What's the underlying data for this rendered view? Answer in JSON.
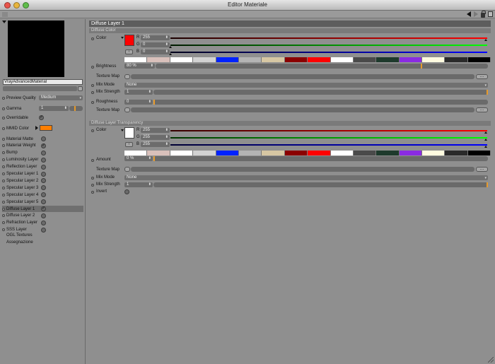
{
  "window": {
    "title": "Editor Materiale"
  },
  "colors": {
    "red": "#ff0000",
    "white": "#ffffff",
    "mmid": "#ff7f00"
  },
  "left_panel": {
    "material_name": "VrayAdvancedMaterial",
    "preview_quality": {
      "label": "Preview Quality",
      "value": "Medium"
    },
    "gamma": {
      "label": "Gamma",
      "value": "1"
    },
    "overridable": {
      "label": "Overridable"
    },
    "mmid": {
      "label": "MMID Color"
    },
    "layers": [
      {
        "label": "Material Matte",
        "checked": false
      },
      {
        "label": "Material Weight",
        "checked": true
      },
      {
        "label": "Bump",
        "checked": false
      },
      {
        "label": "Luminosity Layer",
        "checked": false
      },
      {
        "label": "Reflection Layer",
        "checked": false
      },
      {
        "label": "Specular Layer 1",
        "checked": false
      },
      {
        "label": "Specular Layer 2",
        "checked": false
      },
      {
        "label": "Specular Layer 3",
        "checked": false
      },
      {
        "label": "Specular Layer 4",
        "checked": false
      },
      {
        "label": "Specular Layer 5",
        "checked": false
      },
      {
        "label": "Diffuse Layer 1",
        "checked": true
      },
      {
        "label": "Diffuse Layer 2",
        "checked": false
      },
      {
        "label": "Refraction Layer",
        "checked": false
      },
      {
        "label": "SSS Layer",
        "checked": false
      }
    ],
    "extras": [
      "OGL Textures",
      "Assegnazione"
    ]
  },
  "main": {
    "section_title": "Diffuse Layer 1",
    "diffuse_color": {
      "header": "Diffuse Color",
      "color_label": "Color",
      "r": "255",
      "g": "0",
      "b": "0",
      "r_label": "R",
      "g_label": "G",
      "b_label": "B",
      "brightness_label": "Brightness",
      "brightness": "80 %",
      "texture_map_label": "Texture Map",
      "mix_mode_label": "Mix Mode",
      "mix_mode": "None",
      "mix_strength_label": "Mix Strength",
      "mix_strength": "1",
      "roughness_label": "Roughness",
      "roughness": "0",
      "texture_map2_label": "Texture Map"
    },
    "transparency": {
      "header": "Diffuse Layer Transparency",
      "color_label": "Color",
      "r": "255",
      "g": "255",
      "b": "255",
      "r_label": "R",
      "g_label": "G",
      "b_label": "B",
      "amount_label": "Amount",
      "amount": "0 %",
      "texture_map_label": "Texture Map",
      "mix_mode_label": "Mix Mode",
      "mix_mode": "None",
      "mix_strength_label": "Mix Strength",
      "mix_strength": "1",
      "invert_label": "Invert"
    },
    "palette": [
      "#ffffff",
      "#d9c0bb",
      "#ffffff",
      "#d2d2d2",
      "#0022ff",
      "#b4b4b4",
      "#d7c7a3",
      "#8b0000",
      "#ff0000",
      "#ffffff",
      "#4a4a4a",
      "#1e3a2c",
      "#8a2be2",
      "#fffbe0",
      "#2a2a2a",
      "#000000"
    ]
  }
}
